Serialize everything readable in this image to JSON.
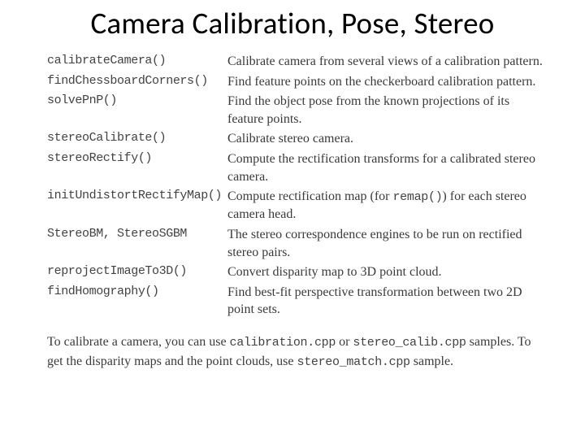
{
  "title": "Camera Calibration, Pose, Stereo",
  "rows": {
    "r0": {
      "fn": "calibrateCamera()",
      "desc": "Calibrate camera from several views of a calibration pattern."
    },
    "r1": {
      "fn": "findChessboardCorners()",
      "desc": "Find feature points on the checkerboard calibration pattern."
    },
    "r2": {
      "fn": "solvePnP()",
      "desc": "Find the object pose from the known projections of its feature points."
    },
    "r3": {
      "fn": "stereoCalibrate()",
      "desc": "Calibrate stereo camera."
    },
    "r4": {
      "fn": "stereoRectify()",
      "desc": "Compute the rectification transforms for a calibrated stereo camera."
    },
    "r5": {
      "fn": "initUndistortRectifyMap()",
      "desc_pre": "Compute rectification map (for ",
      "mono": "remap()",
      "desc_post": ") for each stereo camera head."
    },
    "r6": {
      "fn": "StereoBM, StereoSGBM",
      "desc": "The stereo correspondence engines to be run on rectified stereo pairs."
    },
    "r7": {
      "fn": "reprojectImageTo3D()",
      "desc": "Convert disparity map to 3D point cloud."
    },
    "r8": {
      "fn": "findHomography()",
      "desc": "Find best-fit perspective transformation between two 2D point sets."
    }
  },
  "footer": {
    "p1a": "To calibrate a camera, you can use ",
    "m1": "calibration.cpp",
    "p1b": " or ",
    "m2": "stereo_calib.cpp",
    "p2a": " samples. To get the disparity maps and the point clouds, use ",
    "m3": "stereo_match.cpp",
    "p2b": " sample."
  }
}
